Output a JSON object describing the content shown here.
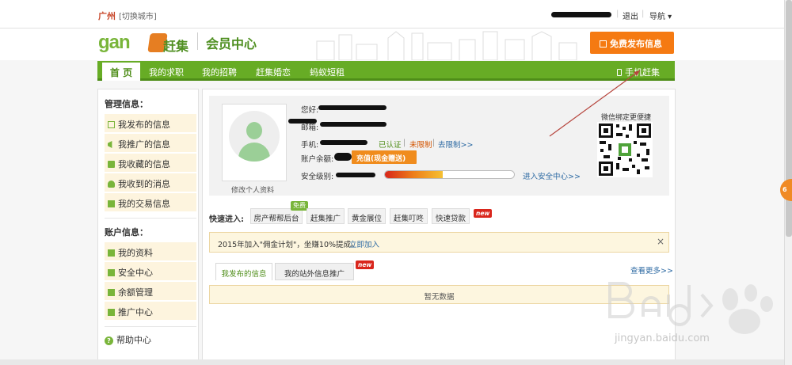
{
  "topbar": {
    "city": "广州",
    "switch_city": "[切换城市]",
    "logout": "退出",
    "nav": "导航 ▾"
  },
  "header": {
    "logo_text": "gan",
    "logo_name": "赶集",
    "member_center": "会员中心",
    "post_button": "免费发布信息"
  },
  "menu": {
    "home": "首 页",
    "items": [
      "我的求职",
      "我的招聘",
      "赶集婚恋",
      "蚂蚁短租"
    ],
    "mobile": "手机赶集"
  },
  "sidebar": {
    "manage_title": "管理信息：",
    "manage_items": [
      "我发布的信息",
      "我推广的信息",
      "我收藏的信息",
      "我收到的消息",
      "我的交易信息"
    ],
    "account_title": "账户信息：",
    "account_items": [
      "我的资料",
      "安全中心",
      "余额管理",
      "推广中心"
    ],
    "help": "帮助中心"
  },
  "profile": {
    "hello_label": "您好:",
    "email_label": "邮箱:",
    "phone_label": "手机:",
    "verified": "已认证",
    "unlimited": "未限制",
    "remove_limit": "去限制>>",
    "balance_label": "账户余额:",
    "recharge": "充值(现金赠送)",
    "security_label": "安全级别:",
    "security_level": 0.45,
    "security_link": "进入安全中心>>",
    "edit_profile": "修改个人资料",
    "wechat_text": "微信绑定更便捷"
  },
  "quick": {
    "label": "快速进入:",
    "buttons": [
      "房产帮帮后台",
      "赶集推广",
      "黄金展位",
      "赶集叮咚",
      "快速贷款"
    ],
    "badge_free": "免费",
    "badge_new": "new"
  },
  "notice": {
    "text": "2015年加入\"佣金计划\"，坐赚10%提成。",
    "link": "立即加入",
    "close": "×"
  },
  "tabs": {
    "active": "我发布的信息",
    "other": "我的站外信息推广",
    "badge_new": "new",
    "view_more": "查看更多>>",
    "empty": "暂无数据"
  },
  "side_widget": {
    "feedback": "6"
  },
  "watermark": {
    "site": "jingyan.baidu.com"
  }
}
